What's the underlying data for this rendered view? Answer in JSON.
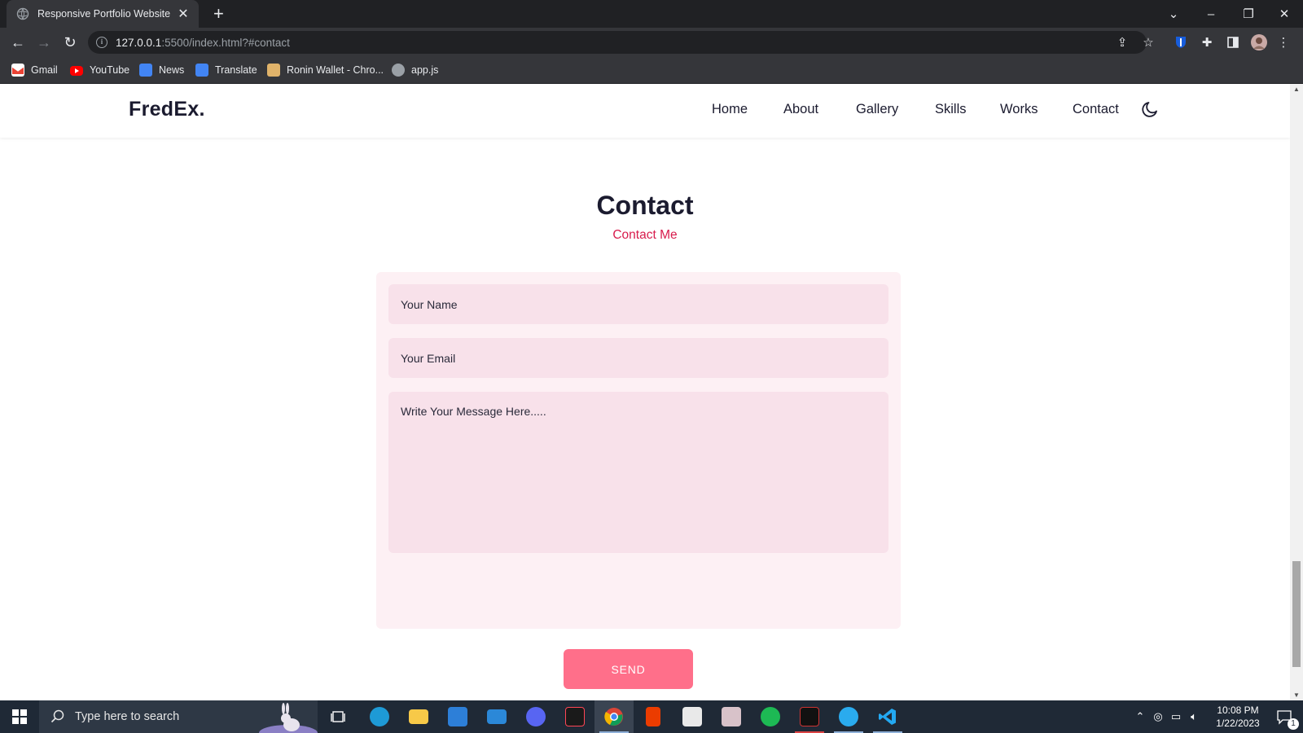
{
  "browser": {
    "tab_title": "Responsive Portfolio Website",
    "url_host": "127.0.0.1",
    "url_path": ":5500/index.html?#contact",
    "bookmarks": [
      {
        "label": "Gmail",
        "icon": "gmail-icon",
        "color": "#ea4335"
      },
      {
        "label": "YouTube",
        "icon": "youtube-icon",
        "color": "#ff0000"
      },
      {
        "label": "News",
        "icon": "news-icon",
        "color": "#4285f4"
      },
      {
        "label": "Translate",
        "icon": "translate-icon",
        "color": "#4285f4"
      },
      {
        "label": "Ronin Wallet - Chro...",
        "icon": "ronin-icon",
        "color": "#e0b36a"
      },
      {
        "label": "app.js",
        "icon": "globe-icon",
        "color": "#9aa0a6"
      }
    ]
  },
  "site": {
    "logo": "FredEx.",
    "nav": [
      "Home",
      "About",
      "Gallery",
      "Skills",
      "Works",
      "Contact"
    ],
    "theme_toggle_icon": "moon-icon"
  },
  "contact": {
    "title": "Contact",
    "subtitle": "Contact Me",
    "name_placeholder": "Your Name",
    "email_placeholder": "Your Email",
    "message_placeholder": "Write Your Message Here.....",
    "send_label": "SEND",
    "accent_color": "#d81b4c",
    "button_color": "#ff6f8a"
  },
  "taskbar": {
    "search_placeholder": "Type here to search",
    "time": "10:08 PM",
    "date": "1/22/2023",
    "notification_count": "1",
    "apps": [
      "task-view-icon",
      "edge-icon",
      "file-explorer-icon",
      "store-icon",
      "mail-icon",
      "discord-icon",
      "valorant-icon",
      "chrome-icon",
      "office-icon",
      "game-icon",
      "anime-app-icon",
      "spotify-icon",
      "game2-icon",
      "telegram-icon",
      "vscode-icon"
    ]
  }
}
